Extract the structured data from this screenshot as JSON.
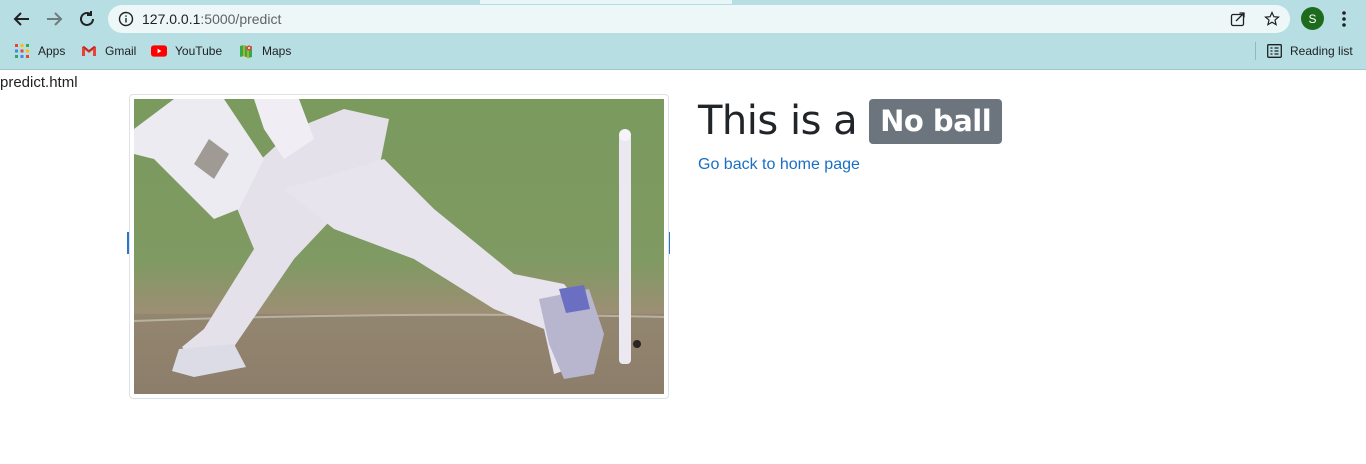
{
  "browser": {
    "url_host": "127.0.0.1",
    "url_path": ":5000/predict",
    "avatar_initial": "S",
    "bookmarks": [
      {
        "label": "Apps",
        "icon": "apps-grid-icon"
      },
      {
        "label": "Gmail",
        "icon": "gmail-icon"
      },
      {
        "label": "YouTube",
        "icon": "youtube-icon"
      },
      {
        "label": "Maps",
        "icon": "maps-icon"
      }
    ],
    "reading_list_label": "Reading list"
  },
  "page": {
    "filename_label": "predict.html",
    "heading_prefix": "This is a",
    "result_badge": "No ball",
    "home_link": "Go back to home page",
    "image_description_icon": "cricket-photo"
  },
  "colors": {
    "chrome_bg": "#b7dfe3",
    "badge_bg": "#6c757d",
    "link": "#1a6fc4"
  }
}
